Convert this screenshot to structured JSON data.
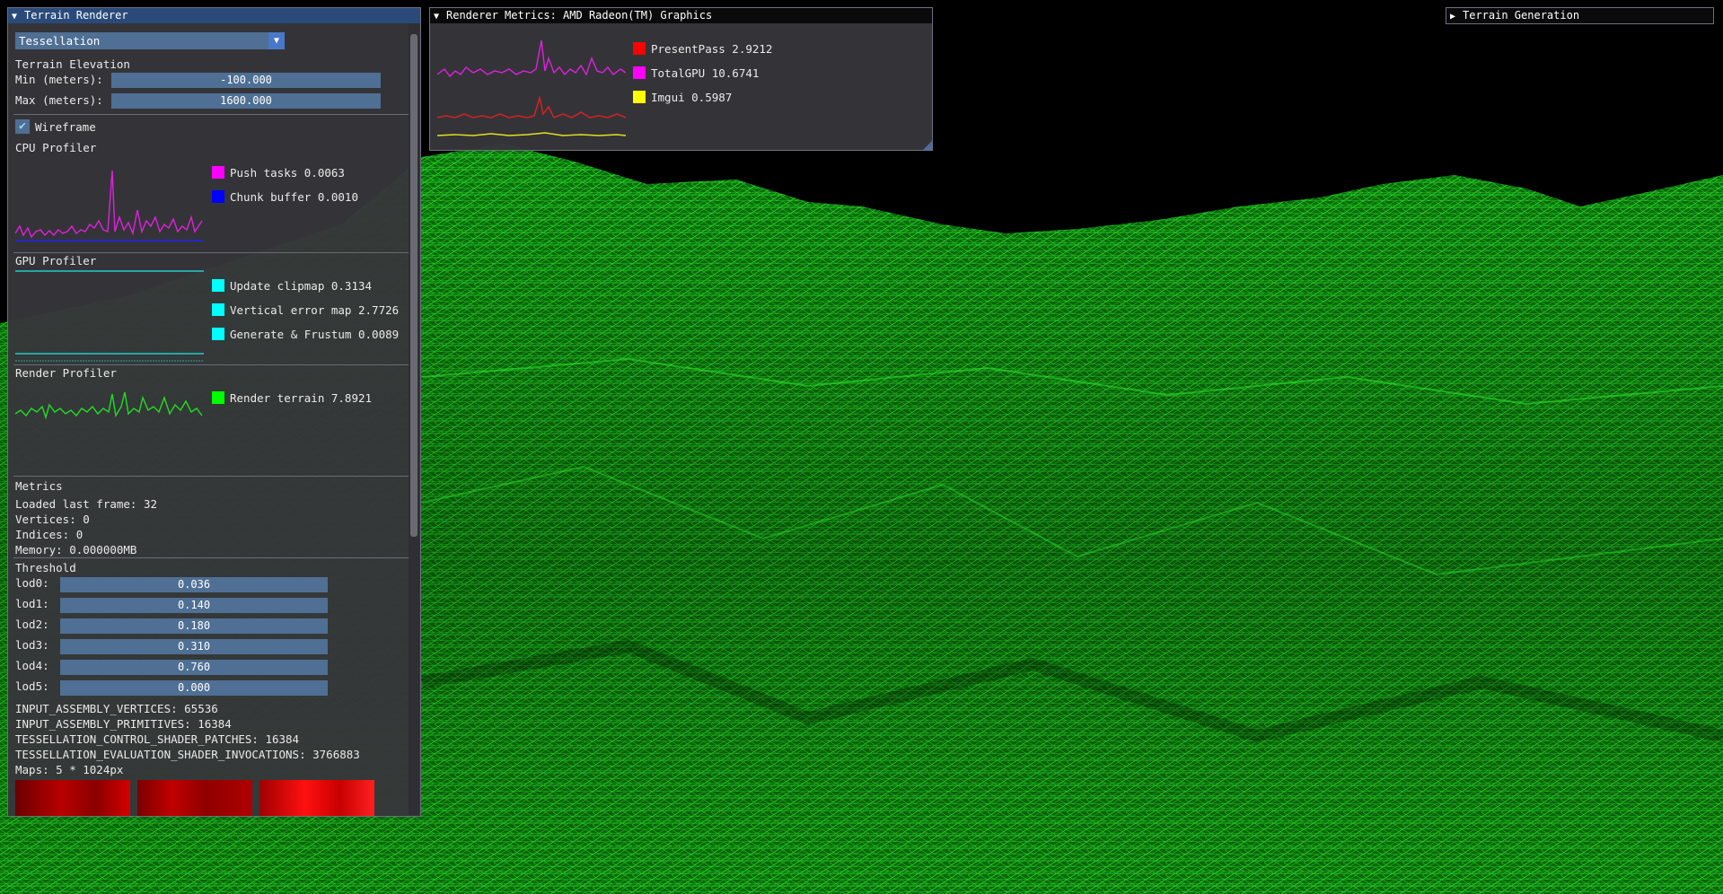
{
  "terrain_renderer": {
    "title": "Terrain Renderer",
    "mode_selected": "Tessellation",
    "elevation_heading": "Terrain Elevation",
    "min_label": "Min (meters):",
    "min_value": "-100.000",
    "max_label": "Max (meters):",
    "max_value": "1600.000",
    "wireframe_label": "Wireframe",
    "wireframe_checked": true,
    "cpu_profiler": {
      "heading": "CPU Profiler",
      "legend": [
        {
          "label": "Push tasks 0.0063",
          "color": "#ff00ff"
        },
        {
          "label": "Chunk buffer 0.0010",
          "color": "#0000ff"
        }
      ]
    },
    "gpu_profiler": {
      "heading": "GPU Profiler",
      "legend": [
        {
          "label": "Update clipmap 0.3134",
          "color": "#00ffff"
        },
        {
          "label": "Vertical error map 2.7726",
          "color": "#00ffff"
        },
        {
          "label": "Generate & Frustum 0.0089",
          "color": "#00ffff"
        }
      ]
    },
    "render_profiler": {
      "heading": "Render Profiler",
      "legend": [
        {
          "label": "Render terrain 7.8921",
          "color": "#00ff00"
        }
      ]
    },
    "metrics": {
      "heading": "Metrics",
      "loaded_last_frame": "Loaded last frame: 32",
      "vertices": "Vertices: 0",
      "indices": "Indices: 0",
      "memory": "Memory: 0.000000MB"
    },
    "threshold": {
      "heading": "Threshold",
      "lods": [
        {
          "label": "lod0:",
          "value": "0.036"
        },
        {
          "label": "lod1:",
          "value": "0.140"
        },
        {
          "label": "lod2:",
          "value": "0.180"
        },
        {
          "label": "lod3:",
          "value": "0.310"
        },
        {
          "label": "lod4:",
          "value": "0.760"
        },
        {
          "label": "lod5:",
          "value": "0.000"
        }
      ]
    },
    "stats": [
      "INPUT_ASSEMBLY_VERTICES: 65536",
      "INPUT_ASSEMBLY_PRIMITIVES: 16384",
      "TESSELLATION_CONTROL_SHADER_PATCHES: 16384",
      "TESSELLATION_EVALUATION_SHADER_INVOCATIONS: 3766883"
    ],
    "maps_label": "Maps: 5 * 1024px"
  },
  "renderer_metrics": {
    "title": "Renderer Metrics: AMD Radeon(TM) Graphics",
    "legend": [
      {
        "label": "PresentPass 2.9212",
        "color": "#ff0000"
      },
      {
        "label": "TotalGPU 10.6741",
        "color": "#ff00ff"
      },
      {
        "label": "Imgui 0.5987",
        "color": "#ffff00"
      }
    ]
  },
  "terrain_generation": {
    "title": "Terrain Generation"
  },
  "colors": {
    "terrain_green": "#0a8a0a",
    "title_active": "#2a4a7a",
    "field_bg": "#4f6f94"
  },
  "icons": {
    "collapse_open": "triangle-down-icon",
    "collapse_closed": "triangle-right-icon",
    "checkmark": "checkmark-icon"
  }
}
